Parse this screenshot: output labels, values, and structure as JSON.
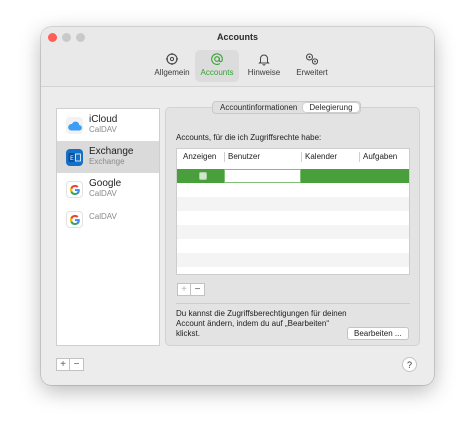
{
  "window": {
    "title": "Accounts"
  },
  "toolbar": {
    "items": [
      {
        "label": "Allgemein",
        "icon": "gear-icon"
      },
      {
        "label": "Accounts",
        "icon": "at-sign-icon",
        "active": true
      },
      {
        "label": "Hinweise",
        "icon": "bell-icon"
      },
      {
        "label": "Erweitert",
        "icon": "gears-icon"
      }
    ]
  },
  "sidebar": {
    "accounts": [
      {
        "name": "iCloud",
        "type": "CalDAV",
        "icon": "icloud-icon"
      },
      {
        "name": "Exchange",
        "type": "Exchange",
        "icon": "exchange-icon",
        "selected": true
      },
      {
        "name": "Google",
        "type": "CalDAV",
        "icon": "google-icon"
      },
      {
        "name": "",
        "type": "CalDAV",
        "icon": "google-icon"
      }
    ],
    "add_label": "+",
    "remove_label": "−"
  },
  "tabs": [
    {
      "label": "Accountinformationen"
    },
    {
      "label": "Delegierung",
      "active": true
    }
  ],
  "delegation": {
    "intro": "Accounts, für die ich Zugriffsrechte habe:",
    "columns": [
      "Anzeigen",
      "Benutzer",
      "Kalender",
      "Aufgaben"
    ],
    "add_label": "+",
    "remove_label": "−",
    "note": "Du kannst die Zugriffsberechtigungen für deinen Account ändern, indem du auf „Bearbeiten“ klickst.",
    "edit_button": "Bearbeiten ..."
  },
  "help_label": "?",
  "colors": {
    "accent": "#36a332",
    "selection": "#4a9f3d"
  }
}
